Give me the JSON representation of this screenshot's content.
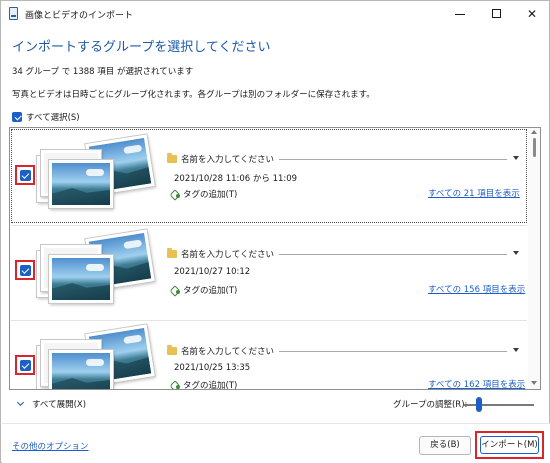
{
  "window": {
    "title": "画像とビデオのインポート"
  },
  "heading": "インポートするグループを選択してください",
  "status_text": "34 グループ で 1388 項目 が選択されています",
  "description": "写真とビデオは日時ごとにグループ化されます。各グループは別のフォルダーに保存されます。",
  "select_all": {
    "label": "すべて選択(S)",
    "checked": true
  },
  "groups": [
    {
      "name_placeholder": "名前を入力してください",
      "date": "2021/10/28 11:06 から 11:09",
      "tag_label": "タグの追加(T)",
      "view_all": "すべての 21 項目を表示",
      "checked": true
    },
    {
      "name_placeholder": "名前を入力してください",
      "date": "2021/10/27 10:12",
      "tag_label": "タグの追加(T)",
      "view_all": "すべての 156 項目を表示",
      "checked": true
    },
    {
      "name_placeholder": "名前を入力してください",
      "date": "2021/10/25 13:35",
      "tag_label": "タグの追加(T)",
      "view_all": "すべての 162 項目を表示",
      "checked": true
    }
  ],
  "expand_all": "すべて展開(X)",
  "group_adjust_label": "グループの調整(R):",
  "more_options": "その他のオプション",
  "buttons": {
    "back": "戻る(B)",
    "import": "インポート(M)"
  },
  "colors": {
    "accent": "#1c5fc7",
    "heading": "#1e5aa8",
    "link": "#1e5ec8",
    "highlight": "#d8262b"
  }
}
